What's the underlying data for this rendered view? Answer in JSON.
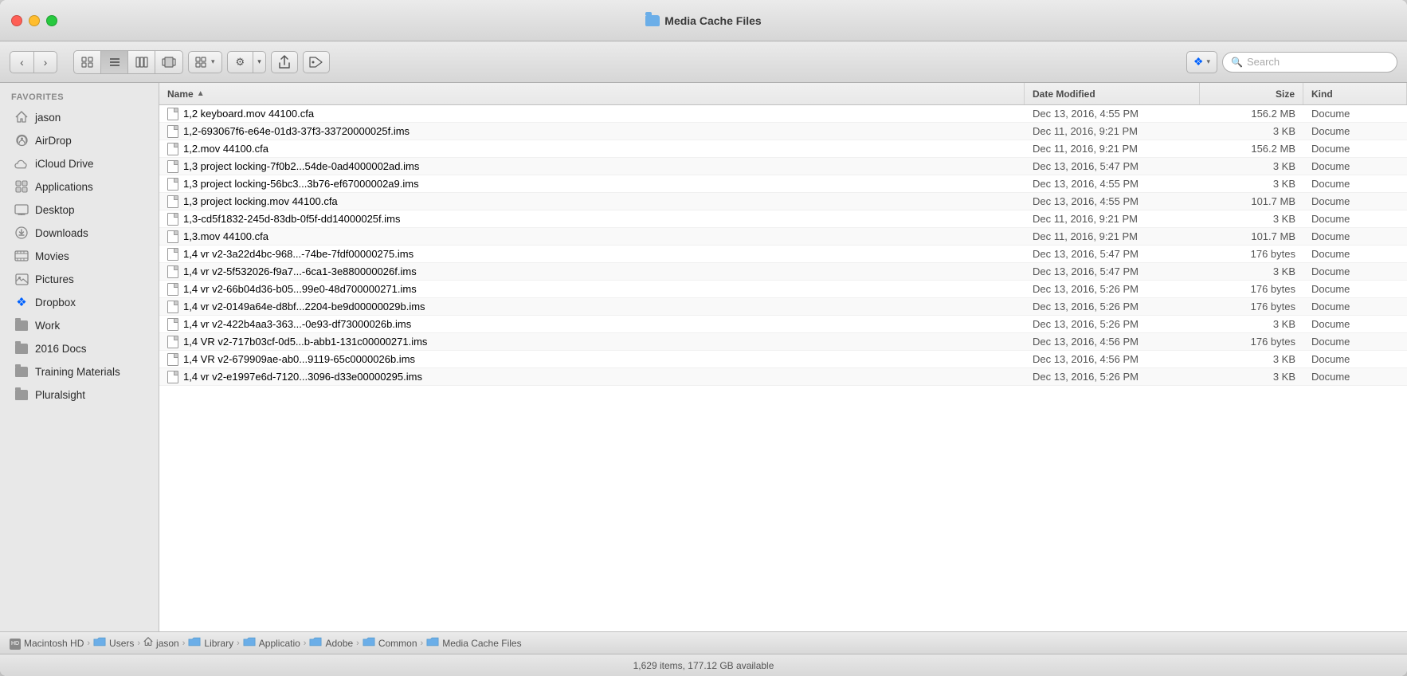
{
  "window": {
    "title": "Media Cache Files"
  },
  "toolbar": {
    "back_label": "‹",
    "forward_label": "›",
    "view_icons_label": "⊞",
    "view_list_label": "☰",
    "view_columns_label": "⧉",
    "view_cover_label": "⊟",
    "view_group_label": "⊟",
    "action_gear_label": "⚙",
    "share_label": "⬆",
    "tag_label": "◯",
    "dropbox_label": "Dropbox",
    "search_placeholder": "Search"
  },
  "sidebar": {
    "favorites_label": "Favorites",
    "items": [
      {
        "id": "jason",
        "label": "jason",
        "icon": "home"
      },
      {
        "id": "airdrop",
        "label": "AirDrop",
        "icon": "airdrop"
      },
      {
        "id": "icloud",
        "label": "iCloud Drive",
        "icon": "icloud"
      },
      {
        "id": "applications",
        "label": "Applications",
        "icon": "apps"
      },
      {
        "id": "desktop",
        "label": "Desktop",
        "icon": "desktop"
      },
      {
        "id": "downloads",
        "label": "Downloads",
        "icon": "downloads"
      },
      {
        "id": "movies",
        "label": "Movies",
        "icon": "movies"
      },
      {
        "id": "pictures",
        "label": "Pictures",
        "icon": "pictures"
      },
      {
        "id": "dropbox",
        "label": "Dropbox",
        "icon": "dropbox"
      },
      {
        "id": "work",
        "label": "Work",
        "icon": "folder"
      },
      {
        "id": "2016docs",
        "label": "2016 Docs",
        "icon": "folder"
      },
      {
        "id": "training",
        "label": "Training Materials",
        "icon": "folder"
      },
      {
        "id": "pluralsight",
        "label": "Pluralsight",
        "icon": "folder"
      }
    ]
  },
  "file_list": {
    "columns": {
      "name": "Name",
      "date": "Date Modified",
      "size": "Size",
      "kind": "Kind"
    },
    "files": [
      {
        "name": "1,2 keyboard.mov 44100.cfa",
        "date": "Dec 13, 2016, 4:55 PM",
        "size": "156.2 MB",
        "kind": "Docume"
      },
      {
        "name": "1,2-693067f6-e64e-01d3-37f3-33720000025f.ims",
        "date": "Dec 11, 2016, 9:21 PM",
        "size": "3 KB",
        "kind": "Docume"
      },
      {
        "name": "1,2.mov 44100.cfa",
        "date": "Dec 11, 2016, 9:21 PM",
        "size": "156.2 MB",
        "kind": "Docume"
      },
      {
        "name": "1,3 project locking-7f0b2...54de-0ad4000002ad.ims",
        "date": "Dec 13, 2016, 5:47 PM",
        "size": "3 KB",
        "kind": "Docume"
      },
      {
        "name": "1,3 project locking-56bc3...3b76-ef67000002a9.ims",
        "date": "Dec 13, 2016, 4:55 PM",
        "size": "3 KB",
        "kind": "Docume"
      },
      {
        "name": "1,3 project locking.mov 44100.cfa",
        "date": "Dec 13, 2016, 4:55 PM",
        "size": "101.7 MB",
        "kind": "Docume"
      },
      {
        "name": "1,3-cd5f1832-245d-83db-0f5f-dd14000025f.ims",
        "date": "Dec 11, 2016, 9:21 PM",
        "size": "3 KB",
        "kind": "Docume"
      },
      {
        "name": "1,3.mov 44100.cfa",
        "date": "Dec 11, 2016, 9:21 PM",
        "size": "101.7 MB",
        "kind": "Docume"
      },
      {
        "name": "1,4 vr v2-3a22d4bc-968...-74be-7fdf00000275.ims",
        "date": "Dec 13, 2016, 5:47 PM",
        "size": "176 bytes",
        "kind": "Docume"
      },
      {
        "name": "1,4 vr v2-5f532026-f9a7...-6ca1-3e880000026f.ims",
        "date": "Dec 13, 2016, 5:47 PM",
        "size": "3 KB",
        "kind": "Docume"
      },
      {
        "name": "1,4 vr v2-66b04d36-b05...99e0-48d700000271.ims",
        "date": "Dec 13, 2016, 5:26 PM",
        "size": "176 bytes",
        "kind": "Docume"
      },
      {
        "name": "1,4 vr v2-0149a64e-d8bf...2204-be9d00000029b.ims",
        "date": "Dec 13, 2016, 5:26 PM",
        "size": "176 bytes",
        "kind": "Docume"
      },
      {
        "name": "1,4 vr v2-422b4aa3-363...-0e93-df73000026b.ims",
        "date": "Dec 13, 2016, 5:26 PM",
        "size": "3 KB",
        "kind": "Docume"
      },
      {
        "name": "1,4 VR v2-717b03cf-0d5...b-abb1-131c00000271.ims",
        "date": "Dec 13, 2016, 4:56 PM",
        "size": "176 bytes",
        "kind": "Docume"
      },
      {
        "name": "1,4 VR v2-679909ae-ab0...9119-65c0000026b.ims",
        "date": "Dec 13, 2016, 4:56 PM",
        "size": "3 KB",
        "kind": "Docume"
      },
      {
        "name": "1,4 vr v2-e1997e6d-7120...3096-d33e00000295.ims",
        "date": "Dec 13, 2016, 5:26 PM",
        "size": "3 KB",
        "kind": "Docume"
      }
    ]
  },
  "breadcrumb": {
    "items": [
      {
        "id": "macintosh-hd",
        "label": "Macintosh HD",
        "icon": "hd"
      },
      {
        "id": "users",
        "label": "Users",
        "icon": "folder-blue"
      },
      {
        "id": "jason",
        "label": "jason",
        "icon": "home"
      },
      {
        "id": "library",
        "label": "Library",
        "icon": "folder-blue"
      },
      {
        "id": "application",
        "label": "Applicatio",
        "icon": "folder-blue"
      },
      {
        "id": "adobe",
        "label": "Adobe",
        "icon": "folder-blue"
      },
      {
        "id": "common",
        "label": "Common",
        "icon": "folder-blue"
      },
      {
        "id": "media-cache-files",
        "label": "Media Cache Files",
        "icon": "folder-blue"
      }
    ]
  },
  "status_bar": {
    "text": "1,629 items, 177.12 GB available"
  }
}
